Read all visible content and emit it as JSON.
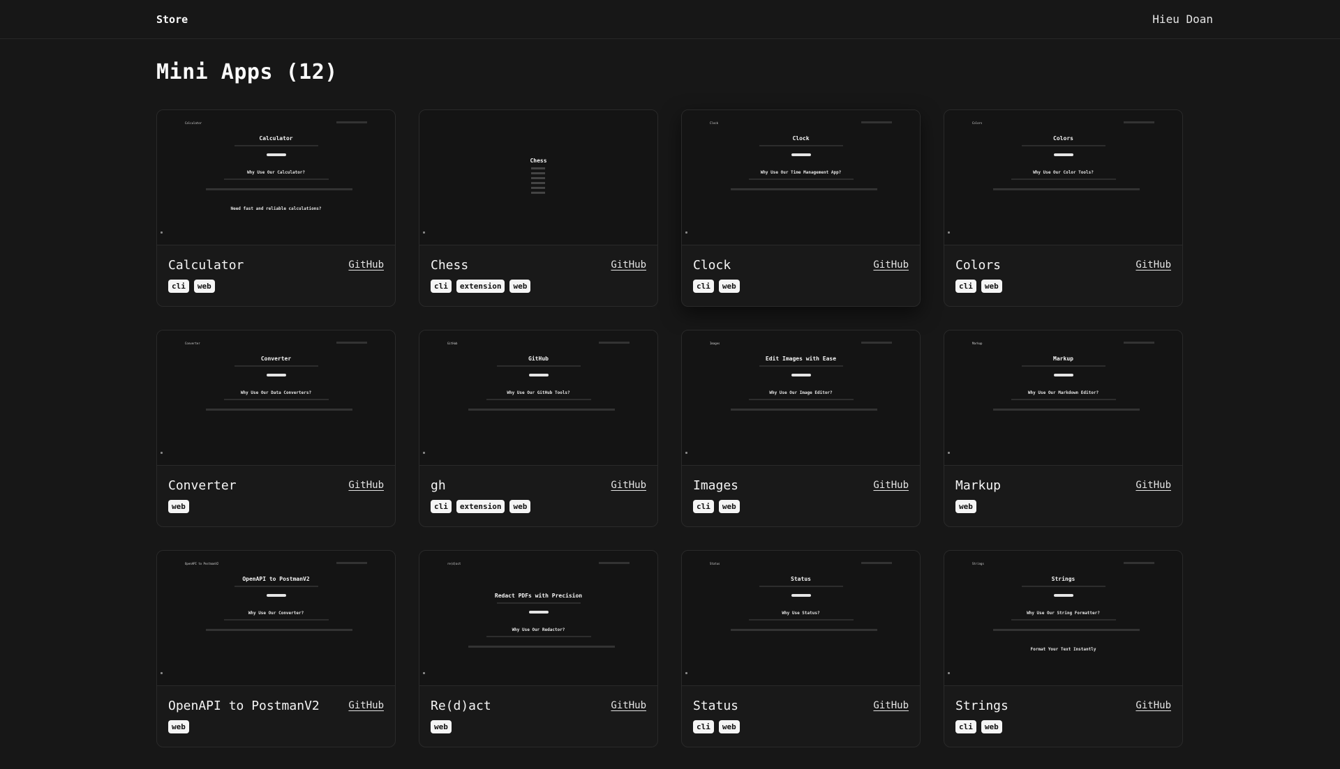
{
  "header": {
    "brand": "Store",
    "user": "Hieu Doan"
  },
  "page": {
    "title": "Mini Apps (12)"
  },
  "apps": [
    {
      "name": "Calculator",
      "link": "GitHub",
      "tags": [
        "cli",
        "web"
      ],
      "thumb": {
        "nav": "Calculator",
        "title": "Calculator",
        "h1": "Why Use Our Calculator?",
        "h2": "Need fast and reliable calculations?"
      }
    },
    {
      "name": "Chess",
      "link": "GitHub",
      "tags": [
        "cli",
        "extension",
        "web"
      ],
      "thumb": {
        "nav": "",
        "title": "Chess",
        "h1": "",
        "h2": ""
      }
    },
    {
      "name": "Clock",
      "link": "GitHub",
      "tags": [
        "cli",
        "web"
      ],
      "thumb": {
        "nav": "Clock",
        "title": "Clock",
        "h1": "Why Use Our Time Management App?",
        "h2": ""
      }
    },
    {
      "name": "Colors",
      "link": "GitHub",
      "tags": [
        "cli",
        "web"
      ],
      "thumb": {
        "nav": "Colors",
        "title": "Colors",
        "h1": "Why Use Our Color Tools?",
        "h2": ""
      }
    },
    {
      "name": "Converter",
      "link": "GitHub",
      "tags": [
        "web"
      ],
      "thumb": {
        "nav": "Converter",
        "title": "Converter",
        "h1": "Why Use Our Data Converters?",
        "h2": ""
      }
    },
    {
      "name": "gh",
      "link": "GitHub",
      "tags": [
        "cli",
        "extension",
        "web"
      ],
      "thumb": {
        "nav": "GitHub",
        "title": "GitHub",
        "h1": "Why Use Our GitHub Tools?",
        "h2": ""
      }
    },
    {
      "name": "Images",
      "link": "GitHub",
      "tags": [
        "cli",
        "web"
      ],
      "thumb": {
        "nav": "Images",
        "title": "Edit Images with Ease",
        "h1": "Why Use Our Image Editor?",
        "h2": ""
      }
    },
    {
      "name": "Markup",
      "link": "GitHub",
      "tags": [
        "web"
      ],
      "thumb": {
        "nav": "Markup",
        "title": "Markup",
        "h1": "Why Use Our Markdown Editor?",
        "h2": ""
      }
    },
    {
      "name": "OpenAPI to PostmanV2",
      "link": "GitHub",
      "tags": [
        "web"
      ],
      "thumb": {
        "nav": "OpenAPI to PostmanV2",
        "title": "OpenAPI to PostmanV2",
        "h1": "Why Use Our Converter?",
        "h2": ""
      }
    },
    {
      "name": "Re(d)act",
      "link": "GitHub",
      "tags": [
        "web"
      ],
      "thumb": {
        "nav": "re(d)act",
        "title": "Redact PDFs with Precision",
        "h1": "Why Use Our Redactor?",
        "h2": ""
      }
    },
    {
      "name": "Status",
      "link": "GitHub",
      "tags": [
        "cli",
        "web"
      ],
      "thumb": {
        "nav": "Status",
        "title": "Status",
        "h1": "Why Use Status?",
        "h2": ""
      }
    },
    {
      "name": "Strings",
      "link": "GitHub",
      "tags": [
        "cli",
        "web"
      ],
      "thumb": {
        "nav": "Strings",
        "title": "Strings",
        "h1": "Why Use Our String Formatter?",
        "h2": "Format Your Text Instantly"
      }
    }
  ]
}
